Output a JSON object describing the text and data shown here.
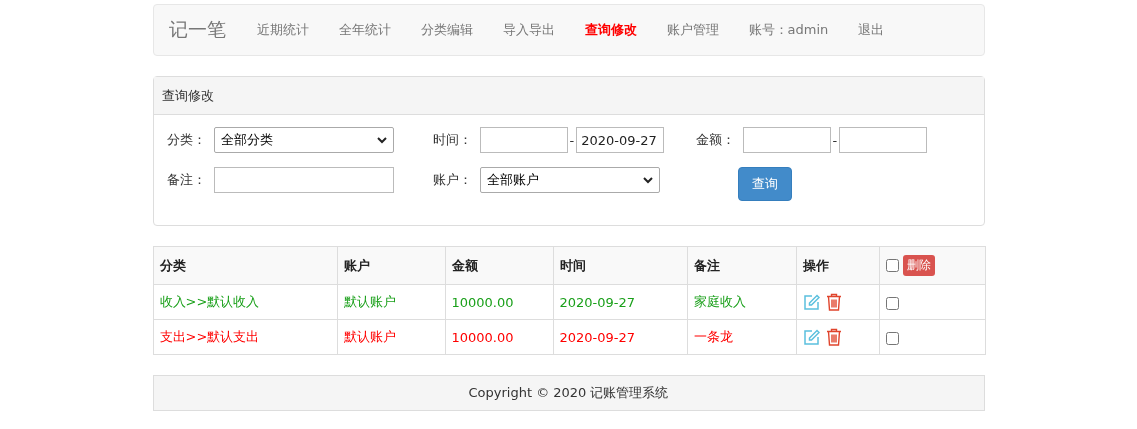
{
  "navbar": {
    "brand": "记一笔",
    "items": [
      {
        "label": "近期统计",
        "selected": false
      },
      {
        "label": "全年统计",
        "selected": false
      },
      {
        "label": "分类编辑",
        "selected": false
      },
      {
        "label": "导入导出",
        "selected": false
      },
      {
        "label": "查询修改",
        "selected": true
      },
      {
        "label": "账户管理",
        "selected": false
      },
      {
        "label": "账号：admin",
        "selected": false
      },
      {
        "label": "退出",
        "selected": false
      }
    ]
  },
  "query_panel": {
    "title": "查询修改",
    "category": {
      "label": "分类：",
      "value": "全部分类"
    },
    "time": {
      "label": "时间：",
      "separator": "-",
      "to": "2020-09-27"
    },
    "amount": {
      "label": "金额：",
      "separator": "-"
    },
    "note": {
      "label": "备注："
    },
    "account": {
      "label": "账户：",
      "value": "全部账户"
    },
    "button": "查询"
  },
  "table": {
    "columns": [
      "分类",
      "账户",
      "金额",
      "时间",
      "备注",
      "操作"
    ],
    "select_all_checked": false,
    "delete_button": "删除",
    "rows": [
      {
        "kind": "income",
        "category": "收入>>默认收入",
        "account": "默认账户",
        "amount": "10000.00",
        "time": "2020-09-27",
        "note": "家庭收入",
        "checked": false
      },
      {
        "kind": "expense",
        "category": "支出>>默认支出",
        "account": "默认账户",
        "amount": "10000.00",
        "time": "2020-09-27",
        "note": "一条龙",
        "checked": false
      }
    ]
  },
  "footer": "Copyright © 2020 记账管理系统"
}
